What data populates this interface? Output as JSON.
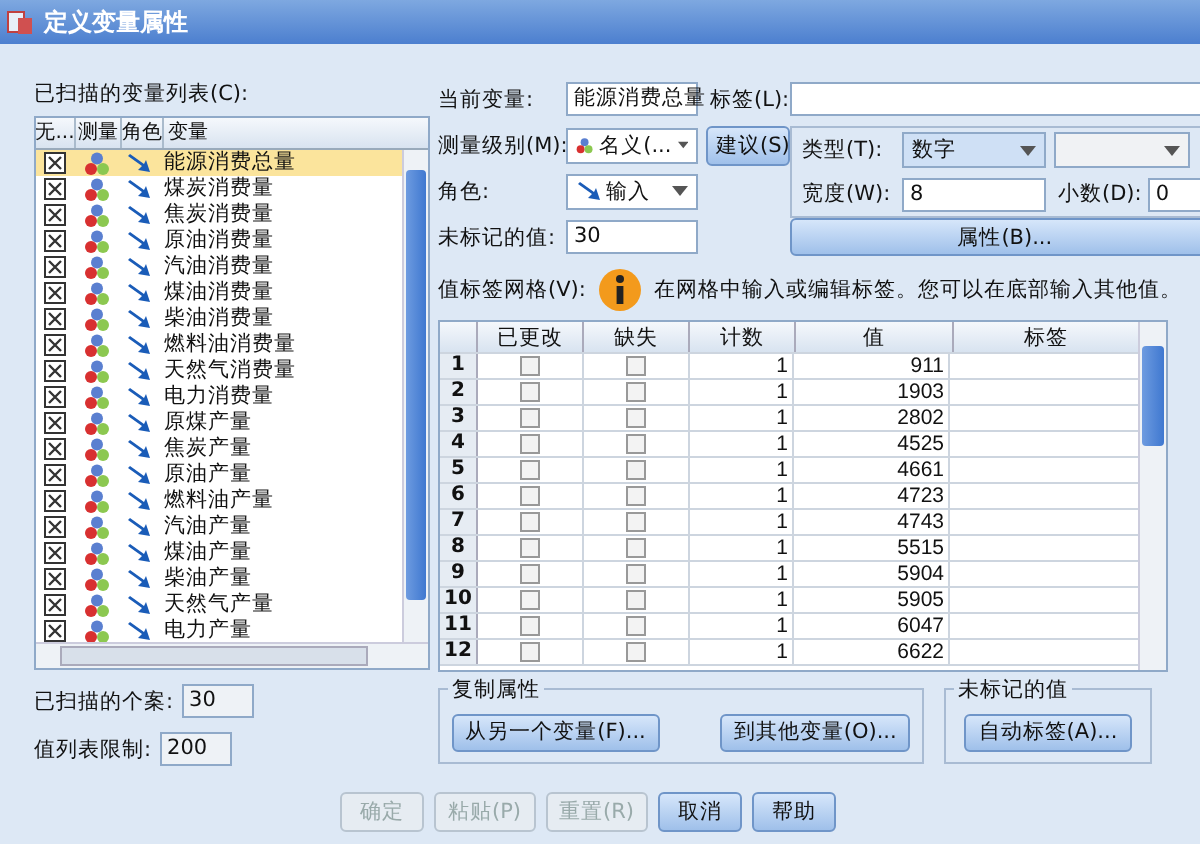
{
  "window": {
    "title": "定义变量属性"
  },
  "scanned_list": {
    "label": "已扫描的变量列表(C):",
    "columns": [
      "无...",
      "测量",
      "角色",
      "变量"
    ],
    "rows": [
      {
        "name": "能源消费总量",
        "checked": true,
        "selected": true
      },
      {
        "name": "煤炭消费量",
        "checked": true,
        "selected": false
      },
      {
        "name": "焦炭消费量",
        "checked": true,
        "selected": false
      },
      {
        "name": "原油消费量",
        "checked": true,
        "selected": false
      },
      {
        "name": "汽油消费量",
        "checked": true,
        "selected": false
      },
      {
        "name": "煤油消费量",
        "checked": true,
        "selected": false
      },
      {
        "name": "柴油消费量",
        "checked": true,
        "selected": false
      },
      {
        "name": "燃料油消费量",
        "checked": true,
        "selected": false
      },
      {
        "name": "天然气消费量",
        "checked": true,
        "selected": false
      },
      {
        "name": "电力消费量",
        "checked": true,
        "selected": false
      },
      {
        "name": "原煤产量",
        "checked": true,
        "selected": false
      },
      {
        "name": "焦炭产量",
        "checked": true,
        "selected": false
      },
      {
        "name": "原油产量",
        "checked": true,
        "selected": false
      },
      {
        "name": "燃料油产量",
        "checked": true,
        "selected": false
      },
      {
        "name": "汽油产量",
        "checked": true,
        "selected": false
      },
      {
        "name": "煤油产量",
        "checked": true,
        "selected": false
      },
      {
        "name": "柴油产量",
        "checked": true,
        "selected": false
      },
      {
        "name": "天然气产量",
        "checked": true,
        "selected": false
      },
      {
        "name": "电力产量",
        "checked": true,
        "selected": false
      }
    ]
  },
  "scanned_cases": {
    "label": "已扫描的个案:",
    "value": "30"
  },
  "value_list_limit": {
    "label": "值列表限制:",
    "value": "200"
  },
  "current_variable": {
    "label": "当前变量:",
    "value": "能源消费总量"
  },
  "label_field": {
    "label": "标签(L):"
  },
  "measurement": {
    "label": "测量级别(M):",
    "value": "名义(..."
  },
  "suggest_button": "建议(S)",
  "type": {
    "label": "类型(T):",
    "value": "数字"
  },
  "width": {
    "label": "宽度(W):",
    "value": "8"
  },
  "decimals": {
    "label": "小数(D):",
    "value": "0"
  },
  "role": {
    "label": "角色:",
    "value": "输入"
  },
  "attributes_button": "属性(B)...",
  "unlabeled": {
    "label": "未标记的值:",
    "value": "30"
  },
  "grid": {
    "label": "值标签网格(V):",
    "hint": "在网格中输入或编辑标签。您可以在底部输入其他值。",
    "columns": [
      "已更改",
      "缺失",
      "计数",
      "值",
      "标签"
    ],
    "rows": [
      {
        "index": "1",
        "changed": false,
        "missing": false,
        "count": "1",
        "value": "911"
      },
      {
        "index": "2",
        "changed": false,
        "missing": false,
        "count": "1",
        "value": "1903"
      },
      {
        "index": "3",
        "changed": false,
        "missing": false,
        "count": "1",
        "value": "2802"
      },
      {
        "index": "4",
        "changed": false,
        "missing": false,
        "count": "1",
        "value": "4525"
      },
      {
        "index": "5",
        "changed": false,
        "missing": false,
        "count": "1",
        "value": "4661"
      },
      {
        "index": "6",
        "changed": false,
        "missing": false,
        "count": "1",
        "value": "4723"
      },
      {
        "index": "7",
        "changed": false,
        "missing": false,
        "count": "1",
        "value": "4743"
      },
      {
        "index": "8",
        "changed": false,
        "missing": false,
        "count": "1",
        "value": "5515"
      },
      {
        "index": "9",
        "changed": false,
        "missing": false,
        "count": "1",
        "value": "5904"
      },
      {
        "index": "10",
        "changed": false,
        "missing": false,
        "count": "1",
        "value": "5905"
      },
      {
        "index": "11",
        "changed": false,
        "missing": false,
        "count": "1",
        "value": "6047"
      },
      {
        "index": "12",
        "changed": false,
        "missing": false,
        "count": "1",
        "value": "6622"
      }
    ]
  },
  "copy_group": {
    "title": "复制属性",
    "buttons": [
      "从另一个变量(F)...",
      "到其他变量(O)..."
    ]
  },
  "unlabeled_group": {
    "title": "未标记的值",
    "button": "自动标签(A)..."
  },
  "footer_buttons": [
    {
      "label": "确定",
      "disabled": true
    },
    {
      "label": "粘贴(P)",
      "disabled": true
    },
    {
      "label": "重置(R)",
      "disabled": true
    },
    {
      "label": "取消",
      "disabled": false
    },
    {
      "label": "帮助",
      "disabled": false
    }
  ]
}
